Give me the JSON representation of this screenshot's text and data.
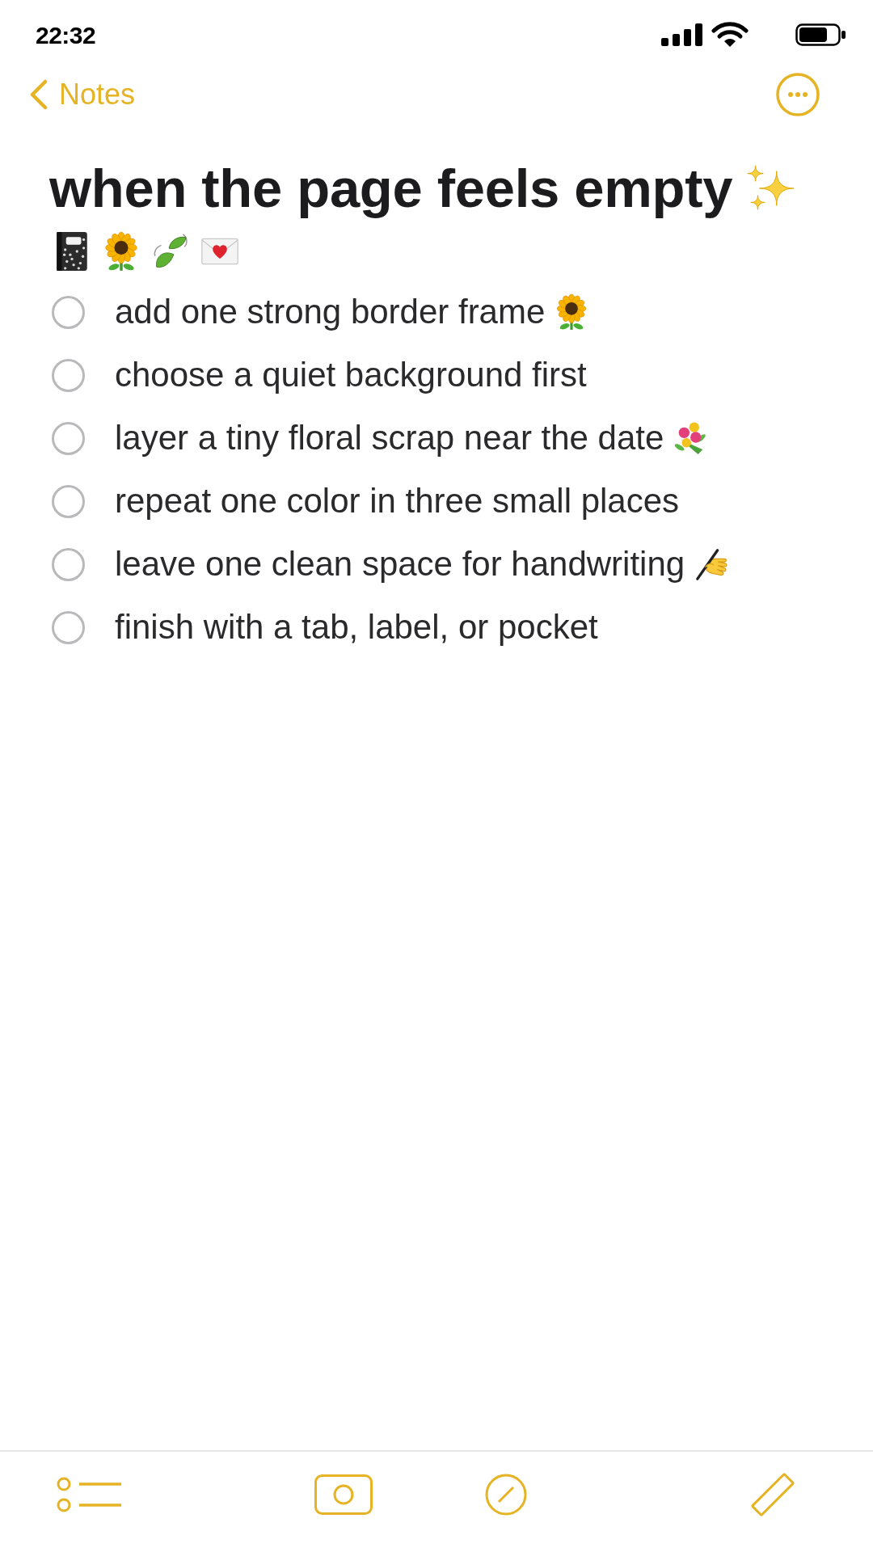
{
  "status_bar": {
    "time": "22:32"
  },
  "nav": {
    "back": "Notes"
  },
  "note": {
    "title": {
      "text": "when the page feels empty",
      "kind": "sparkles"
    },
    "emoji_row": [
      {
        "kind": "notebook"
      },
      {
        "kind": "sunflower"
      },
      {
        "kind": "leaves"
      },
      {
        "kind": "love-letter"
      }
    ],
    "checklist": [
      {
        "text": "add one strong border frame",
        "checked": false,
        "kind": "sunflower"
      },
      {
        "text": "choose a quiet background first",
        "checked": false,
        "kind": "plain"
      },
      {
        "text": "layer a tiny floral scrap near the date",
        "checked": false,
        "kind": "bouquet"
      },
      {
        "text": "repeat one color in three small places",
        "checked": false,
        "kind": "plain"
      },
      {
        "text": "leave one clean space for handwriting",
        "checked": false,
        "kind": "writing-hand"
      },
      {
        "text": "finish with a tab, label, or pocket",
        "checked": false,
        "kind": "plain"
      }
    ]
  }
}
